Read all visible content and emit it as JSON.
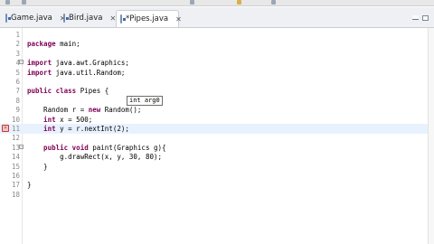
{
  "toolbar": {
    "icons": [
      "toolbar-icon-1",
      "toolbar-icon-2",
      "toolbar-icon-3",
      "toolbar-icon-4",
      "toolbar-icon-5"
    ]
  },
  "tabs": [
    {
      "label": "Game.java",
      "close": "✕"
    },
    {
      "label": "Bird.java",
      "close": "✕"
    },
    {
      "label": "*Pipes.java",
      "close": "✕"
    }
  ],
  "editor": {
    "lines": [
      {
        "n": "1",
        "parts": []
      },
      {
        "n": "2",
        "parts": [
          {
            "k": 1,
            "t": "package"
          },
          {
            "k": 0,
            "t": " main;"
          }
        ]
      },
      {
        "n": "3",
        "parts": []
      },
      {
        "n": "4",
        "parts": [
          {
            "k": 1,
            "t": "import"
          },
          {
            "k": 0,
            "t": " java.awt.Graphics;"
          }
        ]
      },
      {
        "n": "5",
        "parts": [
          {
            "k": 1,
            "t": "import"
          },
          {
            "k": 0,
            "t": " java.util.Random;"
          }
        ]
      },
      {
        "n": "6",
        "parts": []
      },
      {
        "n": "7",
        "parts": [
          {
            "k": 1,
            "t": "public class"
          },
          {
            "k": 0,
            "t": " Pipes {"
          }
        ]
      },
      {
        "n": "8",
        "parts": []
      },
      {
        "n": "9",
        "parts": [
          {
            "k": 0,
            "t": "    Random r = "
          },
          {
            "k": 1,
            "t": "new"
          },
          {
            "k": 0,
            "t": " Random();"
          }
        ]
      },
      {
        "n": "10",
        "parts": [
          {
            "k": 1,
            "t": "    int"
          },
          {
            "k": 0,
            "t": " x = 500;"
          }
        ]
      },
      {
        "n": "11",
        "parts": [
          {
            "k": 1,
            "t": "    int"
          },
          {
            "k": 0,
            "t": " y = r.nextInt(2);"
          }
        ]
      },
      {
        "n": "12",
        "parts": []
      },
      {
        "n": "13",
        "parts": [
          {
            "k": 1,
            "t": "    public void"
          },
          {
            "k": 0,
            "t": " paint(Graphics g){"
          }
        ]
      },
      {
        "n": "14",
        "parts": [
          {
            "k": 0,
            "t": "        g.drawRect(x, y, 30, 80);"
          }
        ]
      },
      {
        "n": "15",
        "parts": [
          {
            "k": 0,
            "t": "    }"
          }
        ]
      },
      {
        "n": "16",
        "parts": []
      },
      {
        "n": "17",
        "parts": [
          {
            "k": 0,
            "t": "}"
          }
        ]
      },
      {
        "n": "18",
        "parts": []
      }
    ],
    "hint_text": "int arg0"
  }
}
